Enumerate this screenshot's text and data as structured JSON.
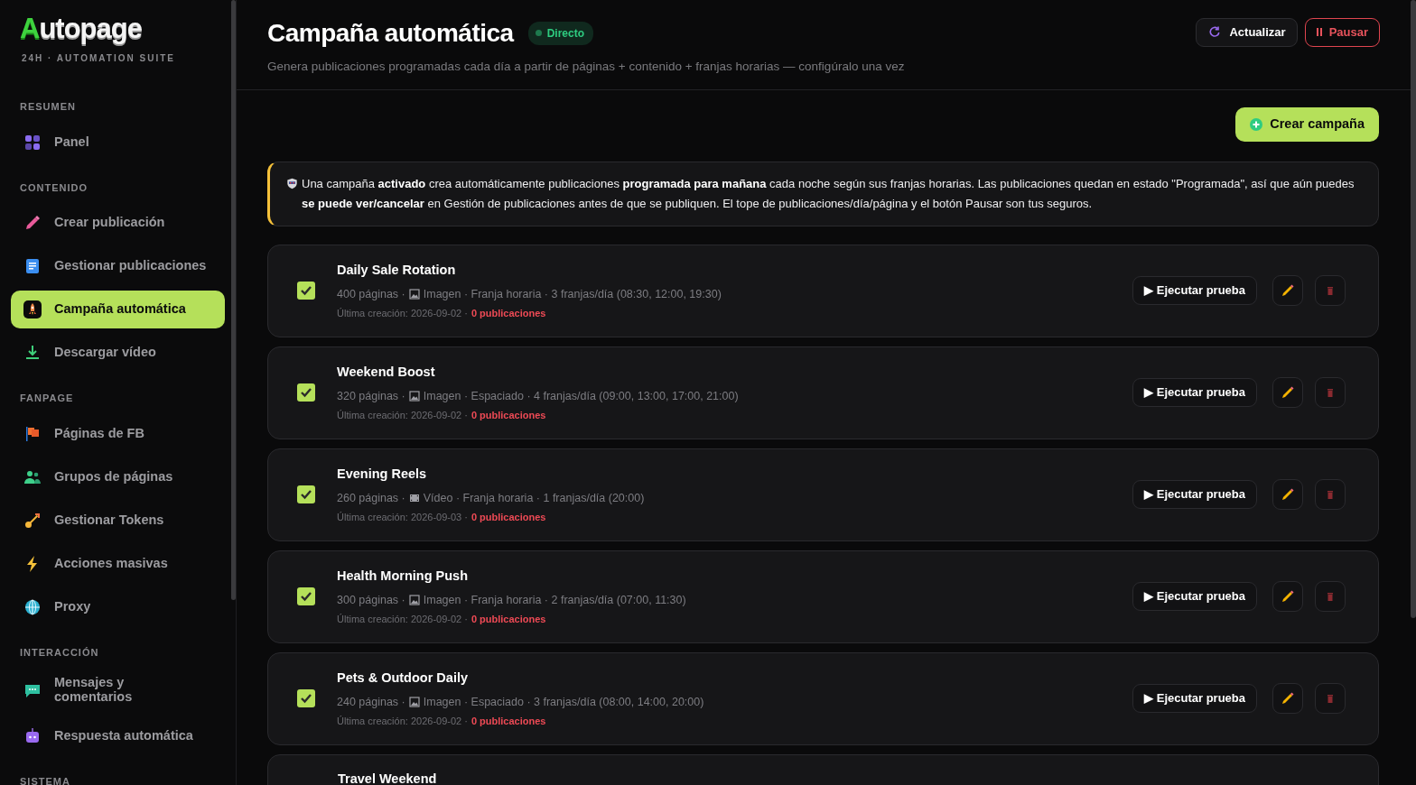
{
  "brand": {
    "logo": "Autopage",
    "tagline": "24H · AUTOMATION SUITE"
  },
  "sidebar": {
    "sections": [
      {
        "title": "RESUMEN",
        "items": [
          {
            "label": "Panel",
            "selected": false
          }
        ]
      },
      {
        "title": "CONTENIDO",
        "items": [
          {
            "label": "Crear publicación",
            "selected": false
          },
          {
            "label": "Gestionar publicaciones",
            "selected": false
          },
          {
            "label": "Campaña automática",
            "selected": true
          },
          {
            "label": "Descargar vídeo",
            "selected": false
          }
        ]
      },
      {
        "title": "FANPAGE",
        "items": [
          {
            "label": "Páginas de FB",
            "selected": false
          },
          {
            "label": "Grupos de páginas",
            "selected": false
          },
          {
            "label": "Gestionar Tokens",
            "selected": false
          },
          {
            "label": "Acciones masivas",
            "selected": false
          },
          {
            "label": "Proxy",
            "selected": false
          }
        ]
      },
      {
        "title": "INTERACCIÓN",
        "items": [
          {
            "label": "Mensajes y comentarios",
            "selected": false
          },
          {
            "label": "Respuesta automática",
            "selected": false
          }
        ]
      },
      {
        "title": "SISTEMA"
      }
    ]
  },
  "header": {
    "title": "Campaña automática",
    "badge": "Directo",
    "subtitle": "Genera publicaciones programadas cada día a partir de páginas + contenido + franjas horarias — configúralo una vez",
    "buttons": [
      {
        "label": "Actualizar",
        "kind": "refresh"
      },
      {
        "label": "Pausar",
        "kind": "pause"
      }
    ]
  },
  "create_button": "Crear campaña",
  "notice": "Una campaña **activado** crea automáticamente publicaciones **programada para mañana** cada noche según sus franjas horarias. Las publicaciones quedan en estado \"Programada\", así que aún puedes **se puede ver/cancelar** en Gestión de publicaciones antes de que se publiquen. El tope de publicaciones/día/página y el botón Pausar son tus seguros.",
  "campaigns": [
    {
      "name": "Daily Sale Rotation",
      "active": true,
      "pages": "400 páginas ·",
      "kind": "image",
      "details": "Imagen · Franja horaria · 3 franjas/día (08:30, 12:00, 19:30)",
      "last": "Última creación: 2026-09-02 ·",
      "posts": "0 publicaciones",
      "run": "▶ Ejecutar prueba"
    },
    {
      "name": "Weekend Boost",
      "active": true,
      "pages": "320 páginas ·",
      "kind": "image",
      "details": "Imagen · Espaciado · 4 franjas/día (09:00, 13:00, 17:00, 21:00)",
      "last": "Última creación: 2026-09-02 ·",
      "posts": "0 publicaciones",
      "run": "▶ Ejecutar prueba"
    },
    {
      "name": "Evening Reels",
      "active": true,
      "pages": "260 páginas ·",
      "kind": "video",
      "details": "Vídeo · Franja horaria · 1 franjas/día (20:00)",
      "last": "Última creación: 2026-09-03 ·",
      "posts": "0 publicaciones",
      "run": "▶ Ejecutar prueba"
    },
    {
      "name": "Health Morning Push",
      "active": true,
      "pages": "300 páginas ·",
      "kind": "image",
      "details": "Imagen · Franja horaria · 2 franjas/día (07:00, 11:30)",
      "last": "Última creación: 2026-09-02 ·",
      "posts": "0 publicaciones",
      "run": "▶ Ejecutar prueba"
    },
    {
      "name": "Pets & Outdoor Daily",
      "active": true,
      "pages": "240 páginas ·",
      "kind": "image",
      "details": "Imagen · Espaciado · 3 franjas/día (08:00, 14:00, 20:00)",
      "last": "Última creación: 2026-09-02 ·",
      "posts": "0 publicaciones",
      "run": "▶ Ejecutar prueba"
    },
    {
      "name": "Travel Weekend"
    }
  ]
}
